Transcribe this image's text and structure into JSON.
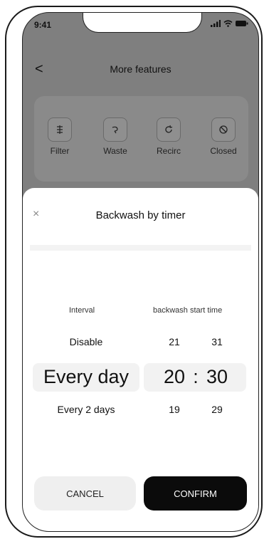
{
  "status_bar": {
    "time": "9:41"
  },
  "header": {
    "back": "<",
    "title": "More features"
  },
  "features": [
    {
      "label": "Filter",
      "icon": "filter-icon"
    },
    {
      "label": "Waste",
      "icon": "waste-icon"
    },
    {
      "label": "Recirc",
      "icon": "recirc-icon"
    },
    {
      "label": "Closed",
      "icon": "closed-icon"
    }
  ],
  "sheet": {
    "close": "×",
    "title": "Backwash by timer",
    "interval_label": "Interval",
    "start_time_label": "backwash start time",
    "interval_above": "Disable",
    "interval_selected": "Every day",
    "interval_below": "Every 2 days",
    "hour_above": "21",
    "hour_selected": "20",
    "hour_below": "19",
    "separator": ":",
    "minute_above": "31",
    "minute_selected": "30",
    "minute_below": "29"
  },
  "actions": {
    "cancel": "CANCEL",
    "confirm": "CONFIRM"
  }
}
